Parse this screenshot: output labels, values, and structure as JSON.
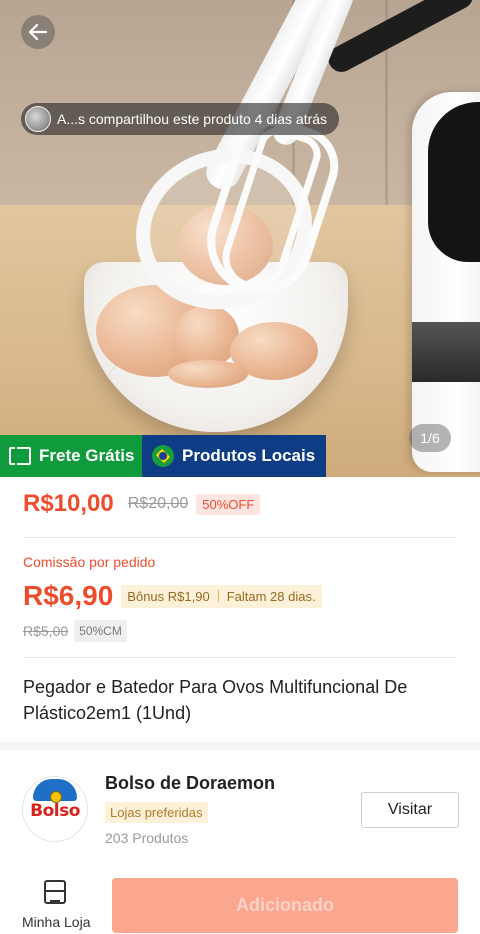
{
  "header": {
    "back_icon": "arrow-left-icon",
    "share_text": "A...s compartilhou este produto 4 dias atrás",
    "image_index": "1/6",
    "badges": {
      "free_shipping": "Frete Grátis",
      "local_products": "Produtos Locais"
    }
  },
  "price": {
    "current": "R$10,00",
    "original": "R$20,00",
    "discount": "50%OFF"
  },
  "commission": {
    "label": "Comissão por pedido",
    "value": "R$6,90",
    "bonus": "Bônus R$1,90",
    "days_left": "Faltam 28 dias.",
    "original": "R$5,00",
    "rate": "50%CM"
  },
  "product": {
    "title": "Pegador e Batedor Para Ovos Multifuncional De Plástico2em1 (1Und)"
  },
  "shop": {
    "logo_text": "Bolso",
    "name": "Bolso de Doraemon",
    "badge": "Lojas preferidas",
    "product_count": "203 Produtos",
    "visit_label": "Visitar"
  },
  "bottom": {
    "my_store_label": "Minha Loja",
    "added_label": "Adicionado"
  },
  "colors": {
    "accent": "#ee4d2d",
    "free_shipping_green": "#0f9b3c",
    "local_blue": "#0e3d86",
    "button_disabled": "#fba68f"
  }
}
